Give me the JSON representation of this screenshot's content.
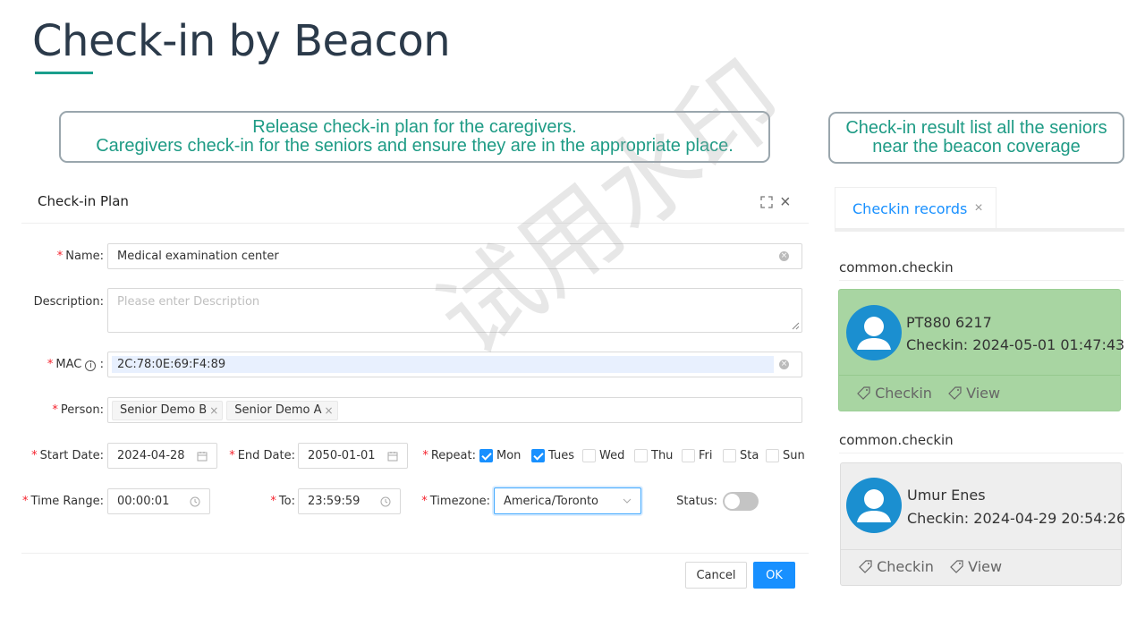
{
  "slide": {
    "title": "Check-in by Beacon",
    "callout_left": {
      "line1": "Release check-in plan for the caregivers.",
      "line2": "Caregivers check-in for the seniors and ensure they are in the appropriate place."
    },
    "callout_right": {
      "line1": "Check-in result list all the seniors",
      "line2": "near the beacon coverage"
    },
    "watermark": "试用水印"
  },
  "dialog": {
    "title": "Check-in Plan",
    "name": {
      "label": "Name",
      "value": "Medical examination center"
    },
    "description": {
      "label": "Description",
      "placeholder": "Please enter Description"
    },
    "mac": {
      "label": "MAC",
      "value": "2C:78:0E:69:F4:89"
    },
    "person": {
      "label": "Person",
      "tags": [
        "Senior Demo B",
        "Senior Demo A"
      ]
    },
    "start_date": {
      "label": "Start Date",
      "value": "2024-04-28"
    },
    "end_date": {
      "label": "End Date",
      "value": "2050-01-01"
    },
    "repeat": {
      "label": "Repeat",
      "days": [
        {
          "label": "Mon",
          "checked": true
        },
        {
          "label": "Tues",
          "checked": true
        },
        {
          "label": "Wed",
          "checked": false
        },
        {
          "label": "Thu",
          "checked": false
        },
        {
          "label": "Fri",
          "checked": false
        },
        {
          "label": "Sta",
          "checked": false
        },
        {
          "label": "Sun",
          "checked": false
        }
      ]
    },
    "time_range": {
      "label": "Time Range",
      "value": "00:00:01"
    },
    "to": {
      "label": "To",
      "value": "23:59:59"
    },
    "timezone": {
      "label": "Timezone",
      "value": "America/Toronto"
    },
    "status": {
      "label": "Status",
      "on": false
    },
    "cancel_label": "Cancel",
    "ok_label": "OK"
  },
  "records": {
    "tab_label": "Checkin records",
    "groups": [
      {
        "section": "common.checkin",
        "name": "PT880 6217",
        "checkin": "Checkin: 2024-05-01 01:47:43",
        "action1": "Checkin",
        "action2": "View",
        "color": "#a8d5a2"
      },
      {
        "section": "common.checkin",
        "name": "Umur Enes",
        "checkin": "Checkin: 2024-04-29 20:54:26",
        "action1": "Checkin",
        "action2": "View",
        "color": "#eeeeee"
      }
    ]
  },
  "colors": {
    "accent": "#1890ff",
    "teal": "#1e9b85",
    "avatar": "#1b8fd0"
  }
}
